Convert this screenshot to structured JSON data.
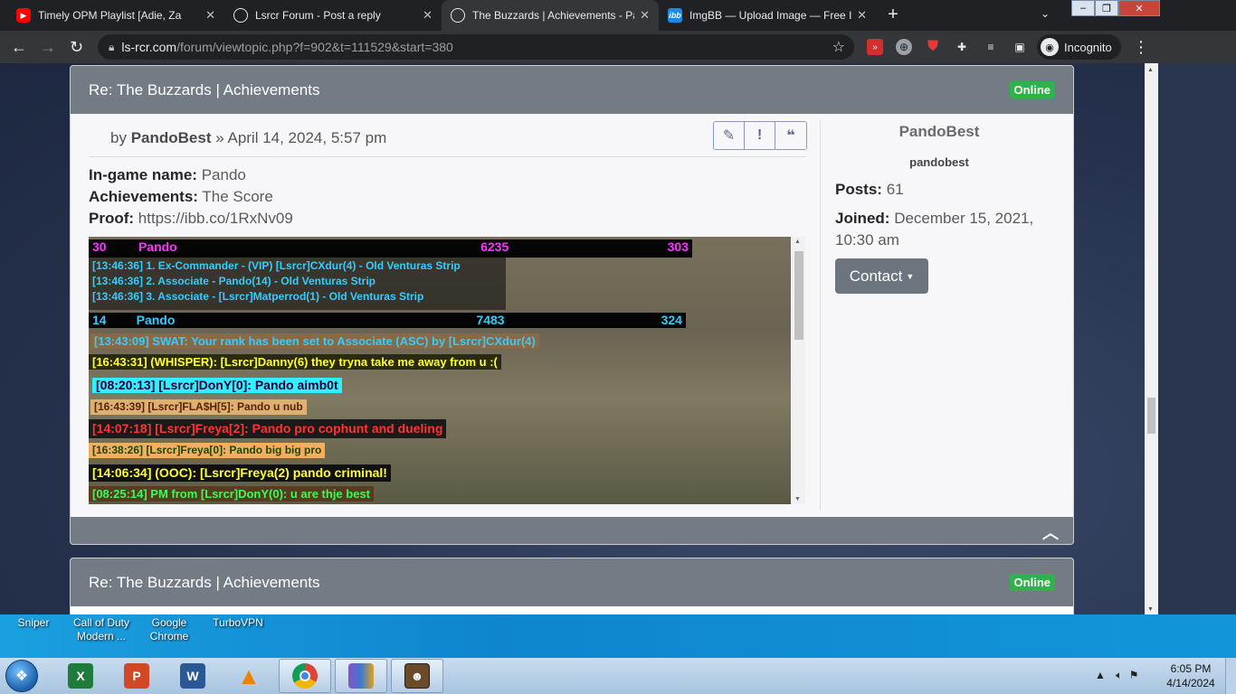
{
  "browser": {
    "tabs": [
      {
        "title": "Timely OPM Playlist [Adie, Za",
        "favicon": "youtube-icon",
        "color": "#ff0000",
        "active": false
      },
      {
        "title": "Lsrcr Forum - Post a reply",
        "favicon": "globe-icon",
        "active": false
      },
      {
        "title": "The Buzzards | Achievements - Pa",
        "favicon": "globe-icon",
        "active": true
      },
      {
        "title": "ImgBB — Upload Image — Free I",
        "favicon": "imgbb-icon",
        "color": "#1e88e5",
        "active": false
      }
    ],
    "new_tab": "+",
    "url_domain": "ls-rcr.com",
    "url_path": "/forum/viewtopic.php?f=902&t=111529&start=380",
    "incognito_label": "Incognito"
  },
  "post1": {
    "title": "Re: The Buzzards | Achievements",
    "status": "Online",
    "by": "by",
    "author": "PandoBest",
    "date": "» April 14, 2024, 5:57 pm",
    "ingame_label": "In-game name:",
    "ingame_value": "Pando",
    "achievements_label": "Achievements:",
    "achievements_value": "The Score",
    "proof_label": "Proof:",
    "proof_value": "https://ibb.co/1RxNv09",
    "screenshot": {
      "score1": {
        "rank": "30",
        "name": "Pando",
        "score": "6235",
        "ping": "303"
      },
      "lines1": [
        "[13:46:36] 1. Ex-Commander - (VIP)  [Lsrcr]CXdur(4) - Old Venturas Strip",
        "[13:46:36] 2. Associate -   Pando(14) - Old Venturas Strip",
        "[13:46:36] 3. Associate - [Lsrcr]Matperrod(1) - Old Venturas Strip"
      ],
      "score2": {
        "rank": "14",
        "name": "Pando",
        "score": "7483",
        "ping": "324"
      },
      "chat": [
        "[13:43:09] SWAT: Your rank has been set to Associate (ASC) by [Lsrcr]CXdur(4)",
        "[16:43:31] (WHISPER): [Lsrcr]Danny(6) they tryna take me away from u :(",
        "[08:20:13] [Lsrcr]DonY[0]: Pando aimb0t",
        "[16:43:39] [Lsrcr]FLA$H[5]: Pando u nub",
        "[14:07:18] [Lsrcr]Freya[2]: Pando pro cophunt and dueling",
        "[16:38:26] [Lsrcr]Freya[0]: Pando big big pro",
        "[14:06:34] (OOC): [Lsrcr]Freya(2) pando criminal!",
        "[08:25:14] PM from [Lsrcr]DonY(0): u are thje best"
      ]
    },
    "profile": {
      "username": "PandoBest",
      "rank": "pandobest",
      "posts_label": "Posts:",
      "posts_value": "61",
      "joined_label": "Joined:",
      "joined_value": "December 15, 2021, 10:30 am",
      "contact": "Contact"
    }
  },
  "post2": {
    "title": "Re: The Buzzards | Achievements",
    "status": "Online"
  },
  "desktop_icons": [
    {
      "label": "Sniper"
    },
    {
      "label": "Call of Duty Modern ..."
    },
    {
      "label": "Google Chrome"
    },
    {
      "label": "TurboVPN"
    }
  ],
  "taskbar": {
    "time": "6:05 PM",
    "date": "4/14/2024",
    "apps": [
      "excel-icon",
      "powerpoint-icon",
      "word-icon",
      "vlc-icon",
      "chrome-icon",
      "winrar-icon",
      "gta-sa-icon"
    ]
  }
}
